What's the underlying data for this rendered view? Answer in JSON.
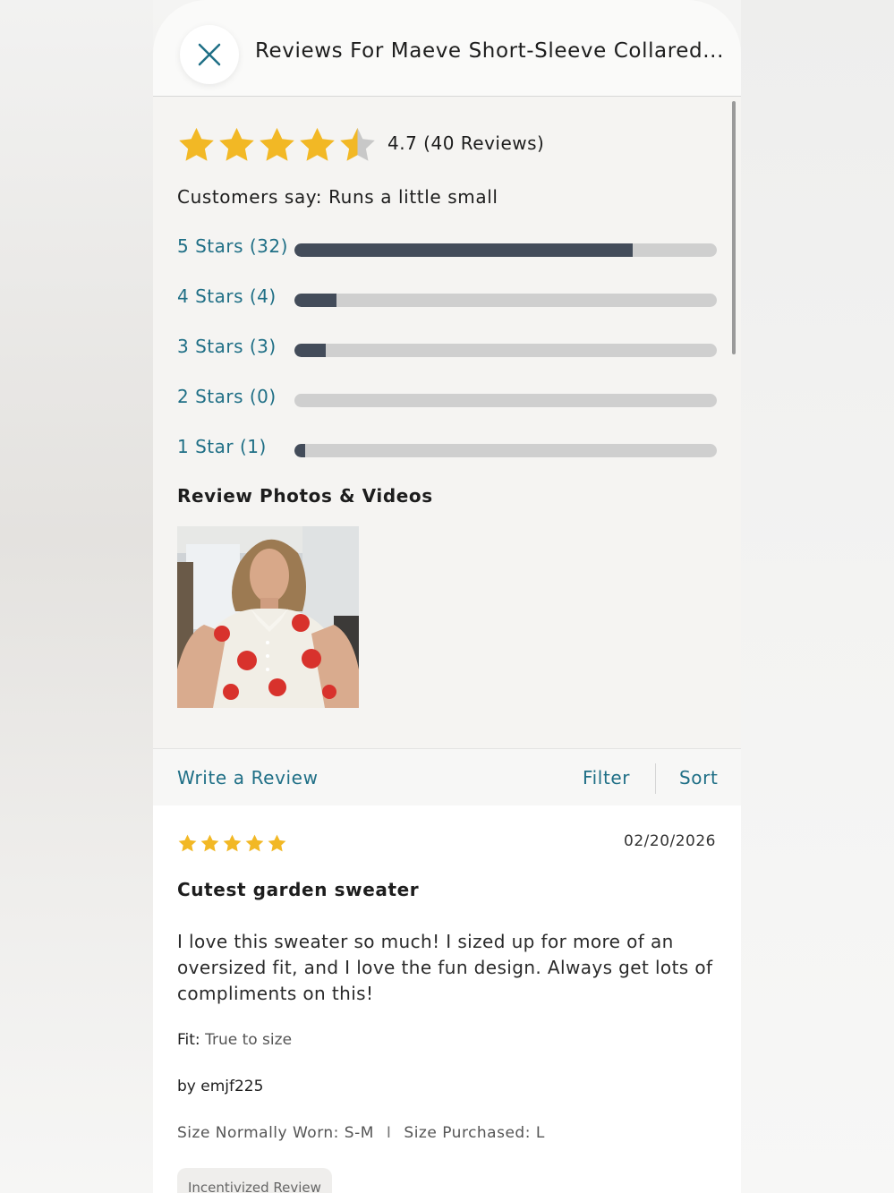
{
  "header": {
    "title": "Reviews For Maeve Short-Sleeve Collared..."
  },
  "summary": {
    "rating": 4.7,
    "rating_text": "4.7 (40 Reviews)",
    "customers_say": "Customers say: Runs a little small",
    "distribution": [
      {
        "label": "5 Stars (32)",
        "count": 32,
        "fill_fraction": 0.8
      },
      {
        "label": "4 Stars (4)",
        "count": 4,
        "fill_fraction": 0.1
      },
      {
        "label": "3 Stars (3)",
        "count": 3,
        "fill_fraction": 0.075
      },
      {
        "label": "2 Stars (0)",
        "count": 0,
        "fill_fraction": 0
      },
      {
        "label": "1 Star (1)",
        "count": 1,
        "fill_fraction": 0.025
      }
    ],
    "photos_title": "Review Photos & Videos"
  },
  "actions": {
    "write_review": "Write a Review",
    "filter": "Filter",
    "sort": "Sort"
  },
  "review": {
    "stars": 5,
    "date": "02/20/2026",
    "title": "Cutest garden sweater",
    "body": "I love this sweater so much! I sized up for more of an oversized fit, and I love the fun design. Always get lots of compliments on this!",
    "fit_label": "Fit:",
    "fit_value": "True to size",
    "author": "by emjf225",
    "size_worn": "Size Normally Worn: S-M",
    "size_separator": "I",
    "size_purchased": "Size Purchased: L",
    "badge": "Incentivized Review"
  },
  "colors": {
    "star": "#f2b825",
    "star_empty": "#c8c8c8",
    "link": "#1f6f86",
    "bar_fill": "#434c5a",
    "bar_track": "#cfcfcf"
  },
  "icons": {
    "close": "close-icon",
    "star": "star-icon"
  }
}
